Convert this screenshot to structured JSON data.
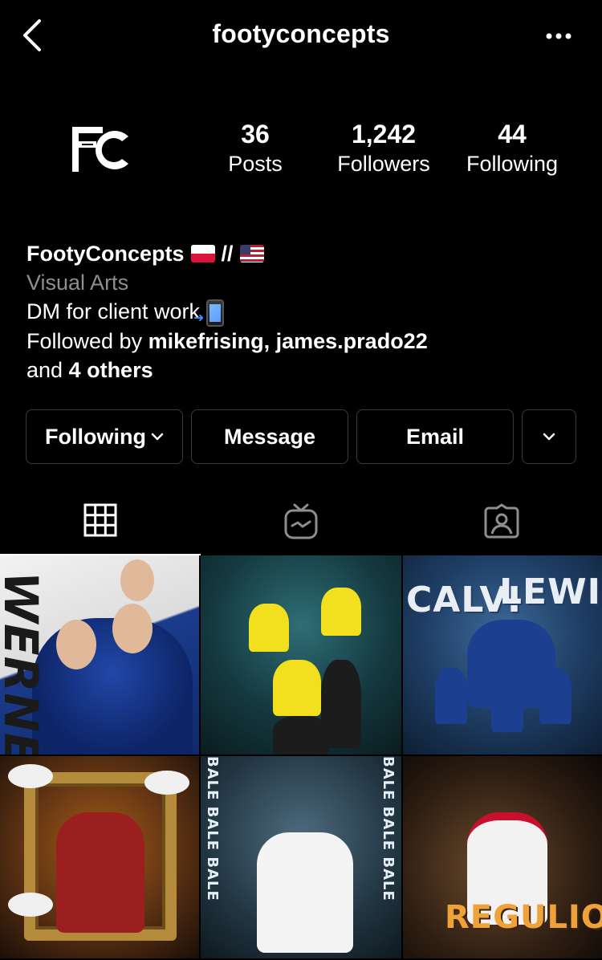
{
  "header": {
    "username": "footyconcepts",
    "back_icon": "chevron-left-icon",
    "more_icon": "more-horizontal-icon"
  },
  "profile": {
    "avatar_text": "FC",
    "stats": {
      "posts_count": "36",
      "posts_label": "Posts",
      "followers_count": "1,242",
      "followers_label": "Followers",
      "following_count": "44",
      "following_label": "Following"
    }
  },
  "bio": {
    "name": "FootyConcepts",
    "name_separator": "//",
    "category": "Visual Arts",
    "description": "DM for client work",
    "followed_by_prefix": "Followed by ",
    "followed_by_users": "mikefrising, james.prado22",
    "followed_by_and": "and ",
    "followed_by_others": "4 others"
  },
  "actions": {
    "following_label": "Following",
    "message_label": "Message",
    "email_label": "Email"
  },
  "tabs": [
    {
      "name": "grid",
      "icon": "grid-icon",
      "active": true
    },
    {
      "name": "igtv",
      "icon": "igtv-icon",
      "active": false
    },
    {
      "name": "tagged",
      "icon": "tagged-user-icon",
      "active": false
    }
  ],
  "posts": [
    {
      "caption": "WERNER"
    },
    {
      "caption": ""
    },
    {
      "caption_a": "CALVI",
      "caption_b": "LEWIN"
    },
    {
      "caption": ""
    },
    {
      "caption": "BALE BALE BALE"
    },
    {
      "caption": "REGULION"
    }
  ],
  "colors": {
    "background": "#000000",
    "text": "#ffffff",
    "muted": "#8e8e8e",
    "button_border": "#3a3a3a"
  }
}
